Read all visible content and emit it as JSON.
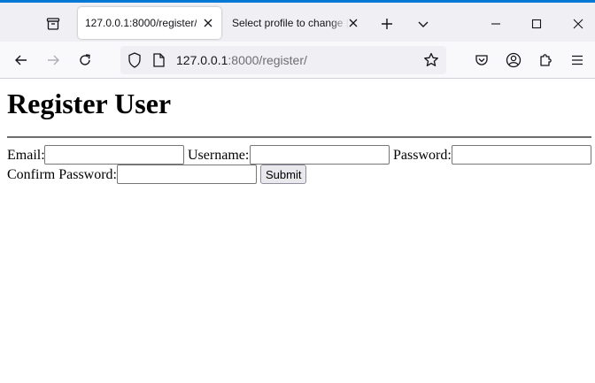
{
  "colors": {
    "accent": "#0078d4",
    "tabbar_bg": "#f0f0f4",
    "navbar_bg": "#f9f9fb",
    "url_host": "#15141a",
    "url_path": "#6d6d75"
  },
  "browser": {
    "tabs": [
      {
        "title": "127.0.0.1:8000/register/",
        "active": true
      },
      {
        "title": "Select profile to change | Django",
        "active": false
      }
    ],
    "url": {
      "host": "127.0.0.1",
      "path": ":8000/register/"
    },
    "icons": {
      "tab_overview": "firefox-view-icon",
      "new_tab": "plus-icon",
      "tab_list": "chevron-down-icon",
      "minimize": "minimize-icon",
      "maximize": "maximize-icon",
      "close": "close-icon",
      "back": "back-arrow-icon",
      "forward": "forward-arrow-icon",
      "reload": "reload-icon",
      "tracking": "shield-icon",
      "page_info": "page-icon",
      "bookmark": "star-icon",
      "pocket": "pocket-icon",
      "account": "account-icon",
      "extensions": "puzzle-icon",
      "menu": "hamburger-menu-icon"
    }
  },
  "page": {
    "heading": "Register User",
    "form": {
      "email_label": "Email:",
      "email_value": "",
      "username_label": "Username:",
      "username_value": "",
      "password_label": "Password:",
      "password_value": "",
      "confirm_label": "Confirm Password:",
      "confirm_value": "",
      "submit_label": "Submit"
    }
  }
}
